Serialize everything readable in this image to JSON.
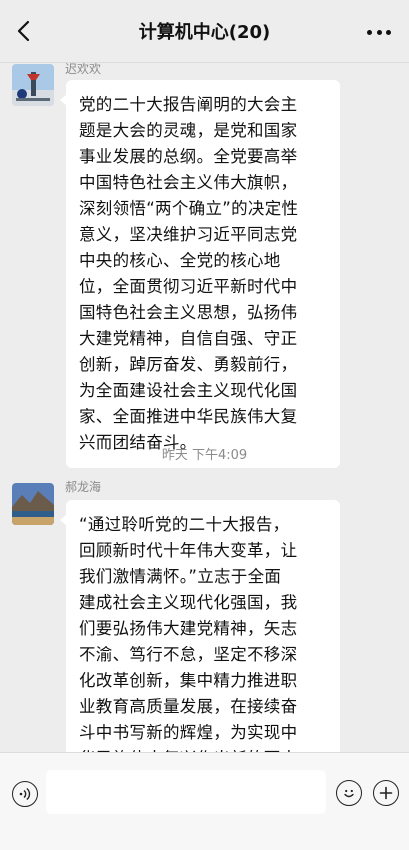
{
  "header": {
    "title": "计算机中心(20)"
  },
  "messages": [
    {
      "sender": "迟欢欢",
      "text": "党的二十大报告阐明的大会主\n题是大会的灵魂，是党和国家\n事业发展的总纲。全党要高举\n中国特色社会主义伟大旗帜，\n深刻领悟“两个确立”的决定性\n意义，坚决维护习近平同志党\n中央的核心、全党的核心地\n位，全面贯彻习近平新时代中\n国特色社会主义思想，弘扬伟\n大建党精神，自信自强、守正\n创新，踔厉奋发、勇毅前行，\n为全面建设社会主义现代化国\n家、全面推进中华民族伟大复\n兴而团结奋斗。"
    },
    {
      "sender": "郝龙海",
      "text": "“通过聆听党的二十大报告，\n回顾新时代十年伟大变革，让\n我们激情满怀。”立志于全面\n建成社会主义现代化强国，我\n们要弘扬伟大建党精神，矢志\n不渝、笃行不怠，坚定不移深\n化改革创新，集中精力推进职\n业教育高质量发展，在接续奋\n斗中书写新的辉煌，为实现中\n华民族伟大复兴作出新的更大\n贡献。"
    }
  ],
  "timestamp": "昨天 下午4:09",
  "input": {
    "value": ""
  }
}
